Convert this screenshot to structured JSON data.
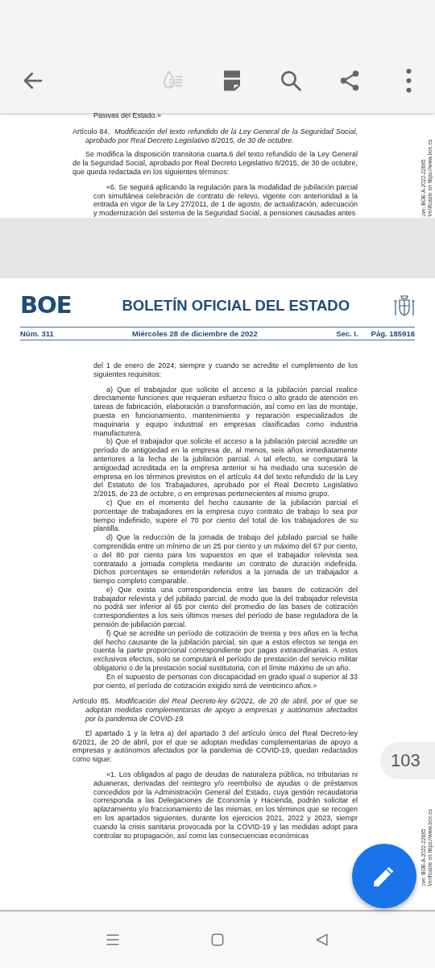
{
  "toolbar": {
    "buttons": [
      {
        "kind": "back",
        "disabled": false
      },
      {
        "kind": "reading-mode",
        "disabled": true
      },
      {
        "kind": "page-layout",
        "disabled": false
      },
      {
        "kind": "search",
        "disabled": false
      },
      {
        "kind": "share",
        "disabled": false
      },
      {
        "kind": "more",
        "disabled": false
      }
    ]
  },
  "pages": [
    {
      "blocks": [
        {
          "kind": "continuation",
          "text": "Pasivas del Estado.»"
        },
        {
          "kind": "article",
          "number": "Artículo 84.",
          "title": "Modificación del texto refundido de la Ley General de la Seguridad Social, aprobado por Real Decreto Legislativo 8/2015, de 30 de octubre."
        },
        {
          "kind": "paragraph",
          "text": "Se modifica la disposición transitoria cuarta.6 del texto refundido de la Ley General de la Seguridad Social, aprobado por Real Decreto Legislativo 8/2015, de 30 de octubre, que queda redactada en los siguientes términos:"
        },
        {
          "kind": "quote",
          "text": "«6. Se seguirá aplicando la regulación para la modalidad de jubilación parcial con simultánea celebración de contrato de relevo, vigente con anterioridad a la entrada en vigor de la Ley 27/2011, de 1 de agosto, de actualización, adecuación y modernización del sistema de la Seguridad Social, a pensiones causadas antes"
        }
      ],
      "side_note": [
        "cve: BOE-A-2022-22685",
        "Verificable en https://www.boe.es"
      ]
    },
    {
      "header": {
        "logo": "BOE",
        "title": "BOLETÍN OFICIAL DEL ESTADO",
        "number": "Núm. 311",
        "date": "Miércoles 28 de diciembre de 2022",
        "section": "Sec. I.",
        "page": "Pág. 185916"
      },
      "blocks": [
        {
          "kind": "continuation",
          "text": "del 1 de enero de 2024, siempre y cuando se acredite el cumplimiento de los siguientes requisitos:"
        },
        {
          "kind": "quote",
          "text": "a) Que el trabajador que solicite el acceso a la jubilación parcial realice directamente funciones que requieran esfuerzo físico o alto grado de atención en tareas de fabricación, elaboración o transformación, así como en las de montaje, puesta en funcionamiento, mantenimiento y reparación especializados de maquinaria y equipo industrial en empresas clasificadas como industria manufacturera."
        },
        {
          "kind": "item",
          "text": "b) Que el trabajador que solicite el acceso a la jubilación parcial acredite un período de antigüedad en la empresa de, al menos, seis años inmediatamente anteriores a la fecha de la jubilación parcial. A tal efecto, se computará la antigüedad acreditada en la empresa anterior si ha mediado una sucesión de empresa en los términos previstos en el artículo 44 del texto refundido de la Ley del Estatuto de los Trabajadores, aprobado por el Real Decreto Legislativo 2/2015, de 23 de octubre, o en empresas pertenecientes al mismo grupo."
        },
        {
          "kind": "item",
          "text": "c) Que en el momento del hecho causante de la jubilación parcial el porcentaje de trabajadores en la empresa cuyo contrato de trabajo lo sea por tiempo indefinido, supere el 70 por ciento del total de los trabajadores de su plantilla."
        },
        {
          "kind": "item",
          "text": "d) Que la reducción de la jornada de trabajo del jubilado parcial se halle comprendida entre un mínimo de un 25 por ciento y un máximo del 67 por ciento, o del 80 por ciento para los supuestos en que el trabajador relevista sea contratado a jornada completa mediante un contrato de duración indefinida. Dichos porcentajes se entenderán referidos a la jornada de un trabajador a tiempo completo comparable."
        },
        {
          "kind": "item",
          "text": "e) Que exista una correspondencia entre las bases de cotización del trabajador relevista y del jubilado parcial, de modo que la del trabajador relevista no podrá ser inferior al 65 por ciento del promedio de las bases de cotización correspondientes a los seis últimos meses del período de base reguladora de la pensión de jubilación parcial."
        },
        {
          "kind": "item",
          "text": "f) Que se acredite un período de cotización de treinta y tres años en la fecha del hecho causante de la jubilación parcial, sin que a estos efectos se tenga en cuenta la parte proporcional correspondiente por pagas extraordinarias. A estos exclusivos efectos, solo se computará el período de prestación del servicio militar obligatorio o de la prestación social sustitutoria, con el límite máximo de un año."
        },
        {
          "kind": "item",
          "text": "En el supuesto de personas con discapacidad en grado igual o superior al 33 por ciento, el período de cotización exigido será de veinticinco años.»"
        },
        {
          "kind": "article",
          "number": "Artículo 85.",
          "title": "Modificación del Real Decreto-ley 6/2021, de 20 de abril, por el que se adoptan medidas complementarias de apoyo a empresas y autónomos afectados por la pandemia de COVID-19."
        },
        {
          "kind": "paragraph",
          "text": "El apartado 1 y la letra a) del apartado 3 del artículo único del Real Decreto-ley 6/2021, de 20 de abril, por el que se adoptan medidas complementarias de apoyo a empresas y autónomos afectados por la pandemia de COVID-19, quedan redactados como sigue:"
        },
        {
          "kind": "quote",
          "text": "«1. Los obligados al pago de deudas de naturaleza pública, no tributarias ni aduaneras, derivadas del reintegro y/o reembolso de ayudas o de préstamos concedidos por la Administración General del Estado, cuya gestión recaudatoria corresponda a las Delegaciones de Economía y Hacienda, podrán solicitar el aplazamiento y/o fraccionamiento de las mismas, en los términos que se recogen en los apartados siguientes, durante los ejercicios 2021, 2022 y 2023, siempr cuando la crisis sanitaria provocada por la COVID-19 y las medidas adopt para controlar su propagación, así como las consecuencias económicas"
        }
      ],
      "side_note": [
        "cve: BOE-A-2022-22685",
        "Verificable en https://www.boe.es"
      ]
    }
  ],
  "page_badge": "103",
  "fab": {
    "kind": "edit"
  },
  "nav": {
    "buttons": [
      {
        "kind": "recents"
      },
      {
        "kind": "home"
      },
      {
        "kind": "back"
      }
    ]
  }
}
